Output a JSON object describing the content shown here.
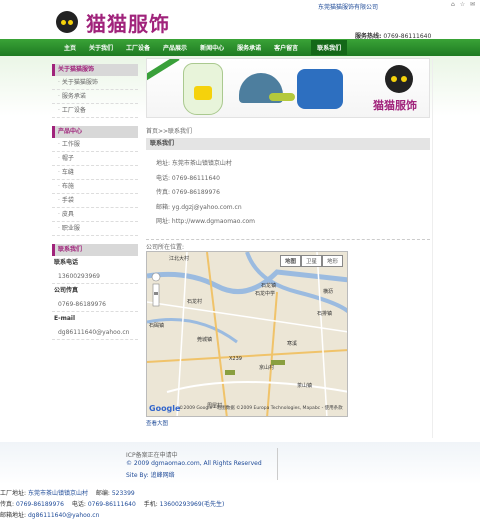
{
  "header": {
    "company_small": "东莞猫猫服饰有限公司",
    "top_icons": [
      "home-icon",
      "favorite-icon",
      "email-icon"
    ],
    "logo_text": "猫猫服饰",
    "hotline_label": "服务热线:",
    "hotline_number": "0769-86111640"
  },
  "nav": {
    "items": [
      "主页",
      "关于我们",
      "工厂设备",
      "产品展示",
      "新闻中心",
      "服务承诺",
      "客户留言",
      "联系我们"
    ],
    "active_index": 7
  },
  "sidebar": {
    "about": {
      "title": "关于猫猫服饰",
      "items": [
        "关于猫猫服饰",
        "服务承诺",
        "工厂设备"
      ]
    },
    "products": {
      "title": "产品中心",
      "items": [
        "工作服",
        "帽子",
        "车缝",
        "布施",
        "手袋",
        "皮具",
        "职业服"
      ]
    },
    "contact": {
      "title": "联系我们",
      "phone_label": "联系电话",
      "phone": "13600293969",
      "fax_label": "公司传真",
      "fax": "0769-86189976",
      "email_label": "E-mail",
      "email": "dg86111640@yahoo.cn"
    }
  },
  "main": {
    "banner_logo_text": "猫猫服饰",
    "breadcrumb": "首页>>联系我们",
    "section_title": "联系我们",
    "info": [
      "地址: 东莞市茶山镇镇京山村",
      "电话: 0769-86111640",
      "传真: 0769-86189976",
      "邮箱: yg.dgzj@yahoo.com.cn",
      "网址: http://www.dgmaomao.com"
    ],
    "map_label": "公司所在位置:",
    "map": {
      "types": [
        "地图",
        "卫星",
        "地形"
      ],
      "selected_type": "地图",
      "logo": "Google",
      "copyright": "©2009 Google - 地图数据 ©2009 Europa Technologies, Mapabc - 使用条款",
      "places": [
        "江北大村",
        "石龙镇",
        "石龙中学",
        "石龙村",
        "石排镇",
        "石碣镇",
        "莞城镇",
        "寒溪",
        "京山村",
        "茶山镇",
        "周屋村",
        "横沥",
        "X239"
      ],
      "link": "查看大图"
    }
  },
  "footer": {
    "icp": "ICP备案正在申请中",
    "copyright": "© 2009 dgmaomao.com, All Rights Reserved",
    "site_by": "Site By: 追峰网络",
    "factory_address_label": "工厂地址:",
    "factory_address": "东莞市茶山镇镇京山村",
    "postcode_label": "邮编:",
    "postcode": "523399",
    "fax_label": "传真:",
    "fax": "0769-86189976",
    "tel_label": "电话:",
    "tel": "0769-86111640",
    "mobile_label": "手机:",
    "mobile": "13600293969(毛先生)",
    "email_label": "邮箱地址:",
    "email": "dg86111640@yahoo.cn"
  },
  "colors": {
    "nav_green": "#2a8f2c",
    "brand_magenta": "#a0237b",
    "link_blue": "#1f4b98"
  }
}
